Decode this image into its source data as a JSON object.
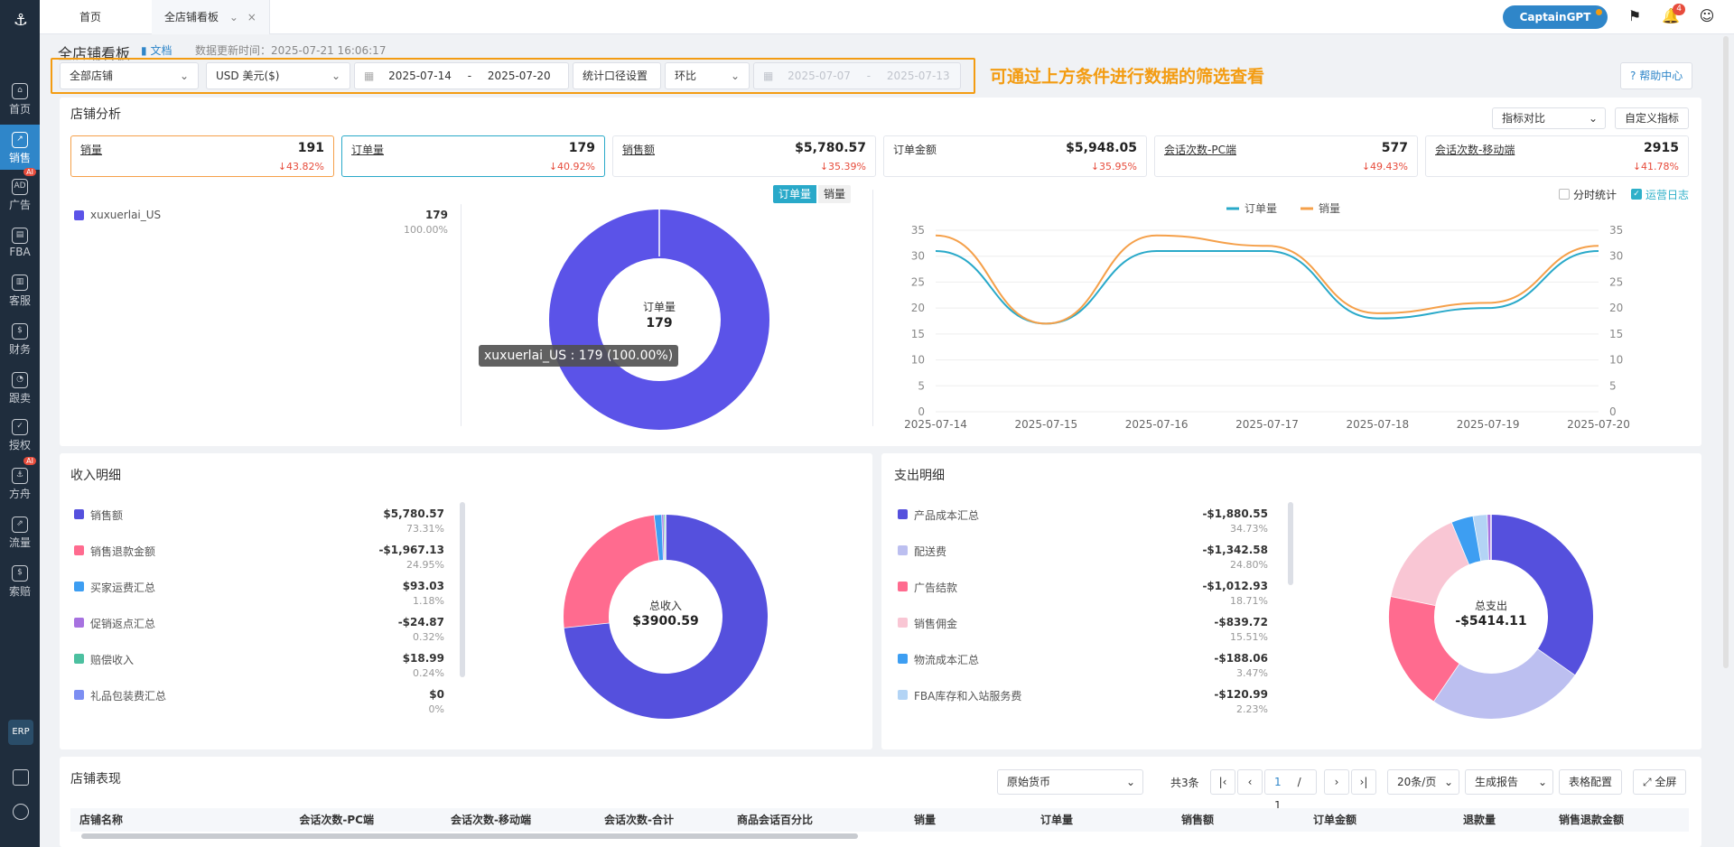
{
  "sidebar": {
    "items": [
      {
        "label": "首页",
        "icon": "home-icon",
        "glyph": "⌂"
      },
      {
        "label": "销售",
        "icon": "chart-icon",
        "glyph": "↗"
      },
      {
        "label": "广告",
        "icon": "ad-icon",
        "glyph": "AD"
      },
      {
        "label": "FBA",
        "icon": "fba-icon",
        "glyph": "▤"
      },
      {
        "label": "客服",
        "icon": "service-icon",
        "glyph": "▥"
      },
      {
        "label": "财务",
        "icon": "finance-icon",
        "glyph": "$"
      },
      {
        "label": "跟卖",
        "icon": "follow-icon",
        "glyph": "◔"
      },
      {
        "label": "授权",
        "icon": "shield-icon",
        "glyph": "✓"
      },
      {
        "label": "方舟",
        "icon": "ark-icon",
        "glyph": "⚓"
      },
      {
        "label": "流量",
        "icon": "traffic-icon",
        "glyph": "⇗"
      },
      {
        "label": "索赔",
        "icon": "claim-icon",
        "glyph": "$"
      }
    ],
    "ai_badge": "AI",
    "erp": "ERP"
  },
  "tabs": {
    "home": "首页",
    "current": "全店铺看板"
  },
  "topbar": {
    "captain": "CaptainGPT",
    "bell_count": "4"
  },
  "header": {
    "title": "全店铺看板",
    "doc": "文档",
    "update_time": "数据更新时间：2025-07-21 16:06:17"
  },
  "filters": {
    "store": "全部店铺",
    "currency": "USD  美元($)",
    "date_from": "2025-07-14",
    "date_sep": "-",
    "date_to": "2025-07-20",
    "caliber": "统计口径设置",
    "compare": "环比",
    "cmp_from": "2025-07-07",
    "cmp_to": "2025-07-13",
    "hint": "可通过上方条件进行数据的筛选查看",
    "help": "帮助中心"
  },
  "analysis": {
    "title": "店铺分析",
    "metric_compare": "指标对比",
    "custom_metric": "自定义指标",
    "cards": [
      {
        "label": "销量",
        "value": "191",
        "delta": "↓43.82%"
      },
      {
        "label": "订单量",
        "value": "179",
        "delta": "↓40.92%"
      },
      {
        "label": "销售额",
        "value": "$5,780.57",
        "delta": "↓35.39%"
      },
      {
        "label": "订单金额",
        "value": "$5,948.05",
        "delta": "↓35.95%"
      },
      {
        "label": "会话次数-PC端",
        "value": "577",
        "delta": "↓49.43%"
      },
      {
        "label": "会话次数-移动端",
        "value": "2915",
        "delta": "↓41.78%"
      }
    ],
    "legend": {
      "name": "xuxuerlai_US",
      "value": "179",
      "pct": "100.00%"
    },
    "toggle_a": "订单量",
    "toggle_b": "销量",
    "donut_label": "订单量",
    "donut_value": "179",
    "tooltip": "xuxuerlai_US : 179 (100.00%)",
    "split_stat": "分时统计",
    "ops_log": "运营日志",
    "colors": {
      "orders": "#29a9c9",
      "sales": "#f5a04a",
      "donut": "#5b53e8"
    }
  },
  "income": {
    "title": "收入明细",
    "center_label": "总收入",
    "center_value": "$3900.59",
    "items": [
      {
        "name": "销售额",
        "value": "$5,780.57",
        "pct": "73.31%",
        "color": "#5550dd"
      },
      {
        "name": "销售退款金额",
        "value": "-$1,967.13",
        "pct": "24.95%",
        "color": "#ff6b8f"
      },
      {
        "name": "买家运费汇总",
        "value": "$93.03",
        "pct": "1.18%",
        "color": "#3d9ef2"
      },
      {
        "name": "促销返点汇总",
        "value": "-$24.87",
        "pct": "0.32%",
        "color": "#a772e0"
      },
      {
        "name": "赔偿收入",
        "value": "$18.99",
        "pct": "0.24%",
        "color": "#4cc0a0"
      },
      {
        "name": "礼品包装费汇总",
        "value": "$0",
        "pct": "0%",
        "color": "#7c8ef2"
      }
    ]
  },
  "expense": {
    "title": "支出明细",
    "center_label": "总支出",
    "center_value": "-$5414.11",
    "items": [
      {
        "name": "产品成本汇总",
        "value": "-$1,880.55",
        "pct": "34.73%",
        "color": "#5550dd"
      },
      {
        "name": "配送费",
        "value": "-$1,342.58",
        "pct": "24.80%",
        "color": "#bcbff0"
      },
      {
        "name": "广告结款",
        "value": "-$1,012.93",
        "pct": "18.71%",
        "color": "#ff6b8f"
      },
      {
        "name": "销售佣金",
        "value": "-$839.72",
        "pct": "15.51%",
        "color": "#f9c6d4"
      },
      {
        "name": "物流成本汇总",
        "value": "-$188.06",
        "pct": "3.47%",
        "color": "#3d9ef2"
      },
      {
        "name": "FBA库存和入站服务费",
        "value": "-$120.99",
        "pct": "2.23%",
        "color": "#b3d4f5"
      }
    ]
  },
  "performance": {
    "title": "店铺表现",
    "currency": "原始货币",
    "total": "共3条",
    "page": "1",
    "pages": "/ 1",
    "per_page": "20条/页",
    "report": "生成报告",
    "config": "表格配置",
    "fullscreen": "全屏",
    "columns": [
      "店铺名称",
      "会话次数-PC端",
      "会话次数-移动端",
      "会话次数-合计",
      "商品会话百分比",
      "销量",
      "订单量",
      "销售额",
      "订单金额",
      "退款量",
      "销售退款金额"
    ]
  },
  "chart_data": [
    {
      "type": "line",
      "x": [
        "2025-07-14",
        "2025-07-15",
        "2025-07-16",
        "2025-07-17",
        "2025-07-18",
        "2025-07-19",
        "2025-07-20"
      ],
      "series": [
        {
          "name": "订单量",
          "values": [
            31,
            17,
            31,
            31,
            18,
            20,
            31
          ]
        },
        {
          "name": "销量",
          "values": [
            34,
            17,
            34,
            32,
            19,
            21,
            32
          ]
        }
      ],
      "ylim": [
        0,
        35
      ],
      "yticks": [
        0,
        5,
        10,
        15,
        20,
        25,
        30,
        35
      ],
      "legend": "top-center"
    },
    {
      "type": "pie",
      "categories": [
        "xuxuerlai_US"
      ],
      "values": [
        179
      ]
    }
  ]
}
